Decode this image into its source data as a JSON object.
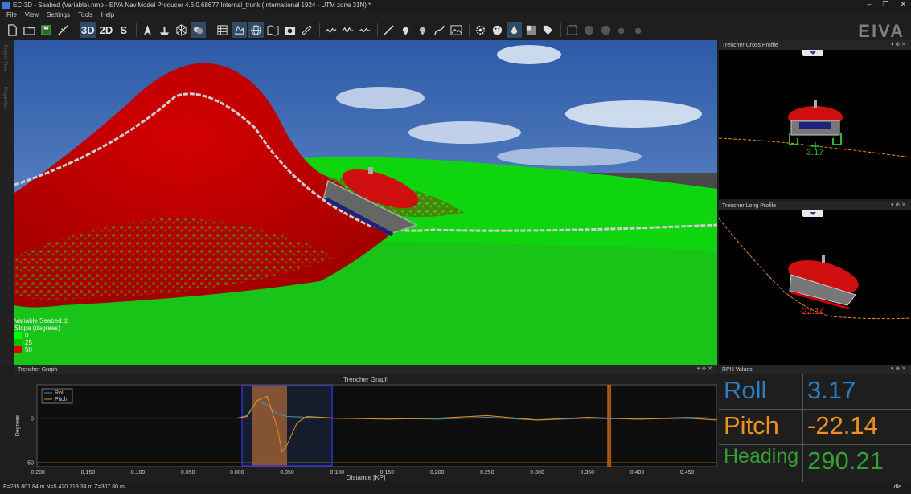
{
  "window": {
    "title": "EC-3D - Seabed (Variable).nmp - EIVA NaviModel Producer 4.6.0.68677 Internal_trunk (International 1924 - UTM zone 31N) *",
    "controls": [
      "–",
      "❐",
      "✕"
    ]
  },
  "menu": [
    "File",
    "View",
    "Settings",
    "Tools",
    "Help"
  ],
  "toolbar": {
    "btn_3d": "3D",
    "btn_2d": "2D",
    "btn_s": "S"
  },
  "brand": {
    "logo_text": "EIVA"
  },
  "left_dock": {
    "tab1": "Project Tree",
    "tab2": "Properties"
  },
  "legend": {
    "title_line1": "Variable Seabed.tb",
    "title_line2": "Slope (degrees)",
    "items": [
      {
        "label": "0",
        "color": "#00ff00"
      },
      {
        "label": "25",
        "color": "#00c000"
      },
      {
        "label": "50",
        "color": "#e00000"
      }
    ]
  },
  "cross_profile": {
    "title": "Trencher Cross Profile",
    "value": "3.17"
  },
  "long_profile": {
    "title": "Trencher Long Profile",
    "value": "-22.14"
  },
  "panel_controls": "▾ ⊕ ✕",
  "trencher_graph": {
    "panel_title": "Trencher Graph",
    "chart_title": "Trencher Graph",
    "ylabel": "Degrees",
    "xlabel": "Distance [KP]",
    "yticks": [
      "0",
      "-50"
    ],
    "xticks": [
      "-0.200",
      "-0.150",
      "-0.100",
      "-0.050",
      "0.000",
      "0.050",
      "0.100",
      "0.150",
      "0.200",
      "0.250",
      "0.300",
      "0.350",
      "0.400",
      "0.450"
    ],
    "legend": [
      {
        "name": "Roll",
        "color": "#4a8fa8"
      },
      {
        "name": "Pitch",
        "color": "#e08a20"
      }
    ]
  },
  "chart_data": {
    "type": "line",
    "xlabel": "Distance [KP]",
    "ylabel": "Degrees",
    "xlim": [
      -0.2,
      0.48
    ],
    "ylim": [
      -55,
      38
    ],
    "series": [
      {
        "name": "Roll",
        "x": [
          0.0,
          0.01,
          0.02,
          0.03,
          0.04,
          0.05,
          0.07,
          0.1,
          0.15,
          0.2,
          0.25,
          0.3,
          0.35,
          0.4,
          0.45,
          0.48
        ],
        "y": [
          0,
          3,
          20,
          15,
          5,
          2,
          1,
          0,
          0,
          -1,
          1,
          -2,
          0,
          -1,
          1,
          0
        ]
      },
      {
        "name": "Pitch",
        "x": [
          0.0,
          0.01,
          0.02,
          0.03,
          0.04,
          0.045,
          0.05,
          0.06,
          0.07,
          0.1,
          0.15,
          0.2,
          0.25,
          0.3,
          0.35,
          0.4,
          0.45,
          0.48
        ],
        "y": [
          0,
          2,
          20,
          25,
          -10,
          -38,
          -30,
          -5,
          2,
          0,
          -1,
          0,
          3,
          -2,
          1,
          -1,
          0,
          -2
        ]
      }
    ],
    "selection": {
      "x_start": 0.005,
      "x_end": 0.095
    },
    "markers": [
      {
        "x_start": 0.015,
        "x_end": 0.05
      },
      {
        "x_start": 0.37,
        "x_end": 0.374
      }
    ]
  },
  "rph": {
    "title": "RPH Values",
    "rows": [
      {
        "label": "Roll",
        "value": "3.17",
        "color": "#2e7fc2"
      },
      {
        "label": "Pitch",
        "value": "-22.14",
        "color": "#f0901e"
      },
      {
        "label": "Heading",
        "value": "290.21",
        "color": "#33a030"
      }
    ]
  },
  "status": {
    "coords": "E=295 001.84 m  N=5 420 718.34 m  Z=307.80 m",
    "state": "Idle"
  }
}
